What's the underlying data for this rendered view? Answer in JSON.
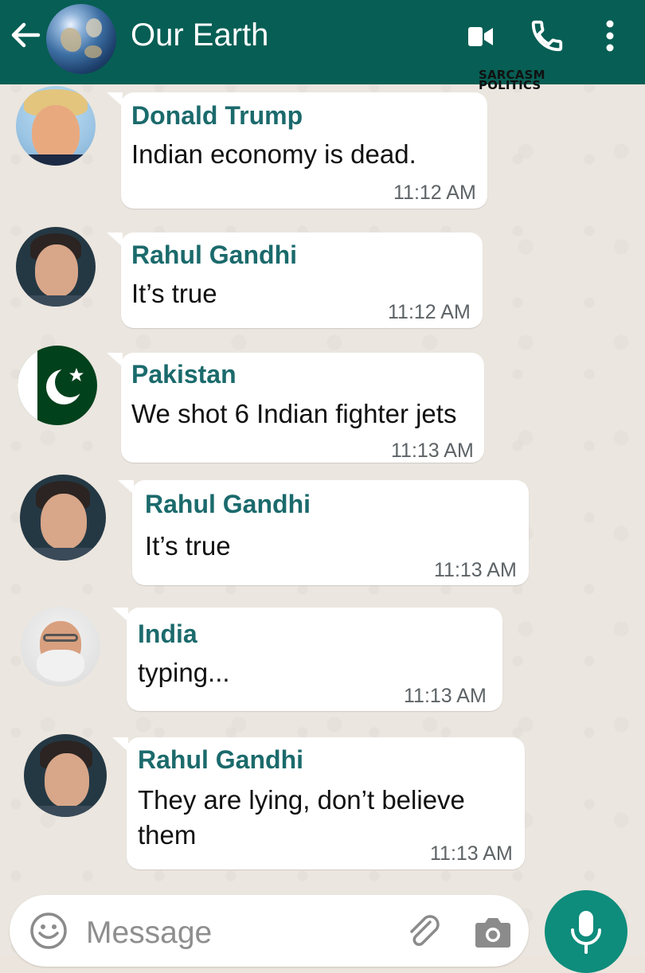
{
  "header": {
    "title": "Our Earth",
    "back_icon": "arrow-left-icon",
    "video_icon": "video-call-icon",
    "call_icon": "phone-icon",
    "menu_icon": "more-vert-icon",
    "background": "#075e54"
  },
  "watermark": {
    "line1": "SARCASM",
    "line2": "POLITICS"
  },
  "messages": [
    {
      "sender": "Donald Trump",
      "text": "Indian economy is dead.",
      "time": "11:12 AM"
    },
    {
      "sender": "Rahul Gandhi",
      "text": "It’s true",
      "time": "11:12 AM"
    },
    {
      "sender": "Pakistan",
      "text": "We shot 6 Indian fighter jets",
      "time": "11:13 AM"
    },
    {
      "sender": "Rahul Gandhi",
      "text": "It’s true",
      "time": "11:13 AM"
    },
    {
      "sender": "India",
      "text": "typing...",
      "time": "11:13 AM"
    },
    {
      "sender": "Rahul Gandhi",
      "text_line1": "They are lying, don’t believe",
      "text_line2": "them",
      "time": "11:13 AM"
    }
  ],
  "composer": {
    "placeholder": "Message",
    "emoji_icon": "emoji-icon",
    "attach_icon": "paperclip-icon",
    "camera_icon": "camera-icon",
    "mic_icon": "microphone-icon"
  },
  "colors": {
    "sender_name": "#1b6a6c",
    "mic_button": "#0e8c7c",
    "bubble": "#ffffff"
  }
}
